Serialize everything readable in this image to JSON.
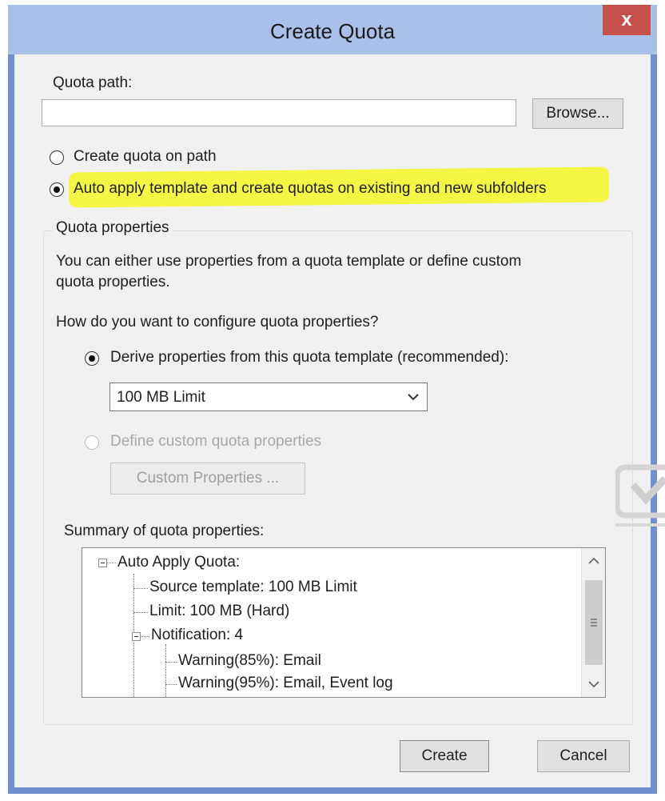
{
  "window": {
    "title": "Create Quota",
    "close_label": "x"
  },
  "quota_path": {
    "label": "Quota path:",
    "value": "",
    "browse_label": "Browse..."
  },
  "mode": {
    "option_path": "Create quota on path",
    "option_auto": "Auto apply template and create quotas on existing and new subfolders",
    "selected": "auto"
  },
  "properties": {
    "group_label": "Quota properties",
    "description_line1": "You can either use properties from a quota template or define custom",
    "description_line2": "quota properties.",
    "question": "How do you want to configure quota properties?",
    "option_template": "Derive properties from this quota template (recommended):",
    "template_value": "100 MB Limit",
    "option_custom": "Define custom quota properties",
    "custom_button": "Custom Properties ...",
    "summary_label": "Summary of quota properties:"
  },
  "summary_tree": [
    {
      "text": "Auto Apply Quota:"
    },
    {
      "text": "Source template: 100 MB Limit"
    },
    {
      "text": "Limit: 100 MB (Hard)"
    },
    {
      "text": "Notification: 4"
    },
    {
      "text": "Warning(85%): Email"
    },
    {
      "text": "Warning(95%): Email, Event log"
    }
  ],
  "footer": {
    "create_label": "Create",
    "cancel_label": "Cancel"
  },
  "colors": {
    "highlight": "#f4f43a",
    "title_bar": "#a9c0e8",
    "close_button": "#c6504c",
    "window_border": "#6f8fcd"
  }
}
